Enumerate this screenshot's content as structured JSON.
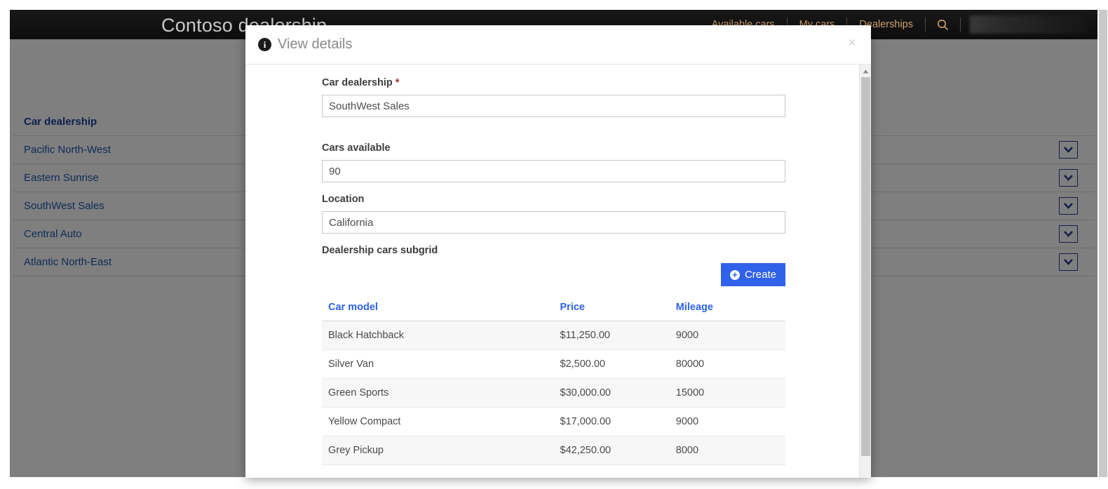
{
  "app": {
    "brand": "Contoso dealership",
    "nav_items": [
      {
        "label": "Available cars"
      },
      {
        "label": "My cars"
      },
      {
        "label": "Dealerships"
      }
    ],
    "search_icon": "search-icon",
    "user_badge": ""
  },
  "background_grid": {
    "column_header": "Car dealership",
    "rows": [
      {
        "name": "Pacific North-West",
        "action_icon": "chevron-down-icon"
      },
      {
        "name": "Eastern Sunrise",
        "action_icon": "chevron-down-icon"
      },
      {
        "name": "SouthWest Sales",
        "action_icon": "chevron-down-icon"
      },
      {
        "name": "Central Auto",
        "action_icon": "chevron-down-icon"
      },
      {
        "name": "Atlantic North-East",
        "action_icon": "chevron-down-icon"
      }
    ]
  },
  "dialog": {
    "icon": "info-icon",
    "title": "View details",
    "close_label": "×",
    "fields": {
      "dealership": {
        "label": "Car dealership",
        "required_marker": "*",
        "value": "SouthWest Sales",
        "placeholder": ""
      },
      "cars_available": {
        "label": "Cars available",
        "value": "90",
        "placeholder": ""
      },
      "location": {
        "label": "Location",
        "value": "California",
        "placeholder": ""
      }
    },
    "subgrid": {
      "label": "Dealership cars subgrid",
      "create_button": "Create",
      "create_icon": "plus-circle-icon",
      "columns": [
        "Car model",
        "Price",
        "Mileage"
      ],
      "rows": [
        {
          "model": "Black Hatchback",
          "price": "$11,250.00",
          "mileage": "9000"
        },
        {
          "model": "Silver Van",
          "price": "$2,500.00",
          "mileage": "80000"
        },
        {
          "model": "Green Sports",
          "price": "$30,000.00",
          "mileage": "15000"
        },
        {
          "model": "Yellow Compact",
          "price": "$17,000.00",
          "mileage": "9000"
        },
        {
          "model": "Grey Pickup",
          "price": "$42,250.00",
          "mileage": "8000"
        }
      ]
    },
    "scrollbar": {
      "up_arrow_icon": "caret-up-icon"
    }
  },
  "colors": {
    "navbar_bg": "#111111",
    "nav_link": "#cfa06a",
    "brand_text": "#c9c9c9",
    "grid_link": "#2255b0",
    "grid_header": "#1f3f9e",
    "accent_blue": "#2f62e8",
    "required_red": "#a4262c",
    "overlay": "rgba(0,0,0,0.5)"
  }
}
